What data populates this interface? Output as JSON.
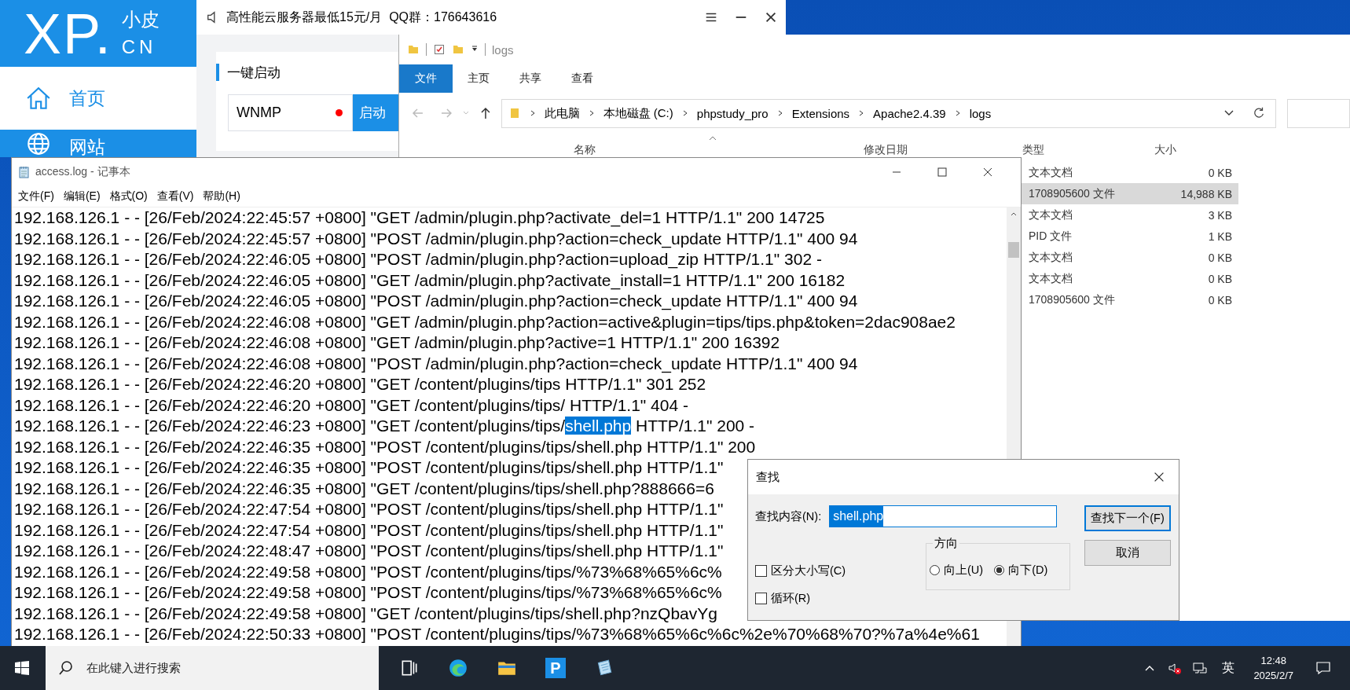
{
  "phpstudy": {
    "logo": {
      "mark": "XP.",
      "top": "小皮",
      "bottom": "CN"
    },
    "notice": "高性能云服务器最低15元/月  QQ群：176643616",
    "nav": [
      {
        "label": "首页",
        "kind": "home",
        "selected": true
      },
      {
        "label": "网站",
        "kind": "globe",
        "selected": false
      }
    ],
    "section_title": "一键启动",
    "service": {
      "name": "WNMP",
      "running": false,
      "action": "启动"
    }
  },
  "explorer": {
    "title": "logs",
    "ribbon_tabs": [
      {
        "label": "文件",
        "selected": true
      },
      {
        "label": "主页",
        "selected": false
      },
      {
        "label": "共享",
        "selected": false
      },
      {
        "label": "查看",
        "selected": false
      }
    ],
    "breadcrumb": [
      "此电脑",
      "本地磁盘 (C:)",
      "phpstudy_pro",
      "Extensions",
      "Apache2.4.39",
      "logs"
    ],
    "columns": [
      "名称",
      "修改日期",
      "类型",
      "大小"
    ],
    "rows": [
      {
        "type": "文本文档",
        "size": "0 KB",
        "selected": false
      },
      {
        "type": "1708905600 文件",
        "size": "14,988 KB",
        "selected": true
      },
      {
        "type": "文本文档",
        "size": "3 KB",
        "selected": false
      },
      {
        "type": "PID 文件",
        "size": "1 KB",
        "selected": false
      },
      {
        "type": "文本文档",
        "size": "0 KB",
        "selected": false
      },
      {
        "type": "文本文档",
        "size": "0 KB",
        "selected": false
      },
      {
        "type": "1708905600 文件",
        "size": "0 KB",
        "selected": false
      }
    ]
  },
  "notepad": {
    "title": "access.log - 记事本",
    "menu": [
      "文件(F)",
      "编辑(E)",
      "格式(O)",
      "查看(V)",
      "帮助(H)"
    ],
    "lines": [
      [
        {
          "text": "192.168.126.1 - - [26/Feb/2024:22:45:57 +0800] \"GET /admin/plugin.php?activate_del=1 HTTP/1.1\" 200 14725",
          "selected": false
        }
      ],
      [
        {
          "text": "192.168.126.1 - - [26/Feb/2024:22:45:57 +0800] \"POST /admin/plugin.php?action=check_update HTTP/1.1\" 400 94",
          "selected": false
        }
      ],
      [
        {
          "text": "192.168.126.1 - - [26/Feb/2024:22:46:05 +0800] \"POST /admin/plugin.php?action=upload_zip HTTP/1.1\" 302 -",
          "selected": false
        }
      ],
      [
        {
          "text": "192.168.126.1 - - [26/Feb/2024:22:46:05 +0800] \"GET /admin/plugin.php?activate_install=1 HTTP/1.1\" 200 16182",
          "selected": false
        }
      ],
      [
        {
          "text": "192.168.126.1 - - [26/Feb/2024:22:46:05 +0800] \"POST /admin/plugin.php?action=check_update HTTP/1.1\" 400 94",
          "selected": false
        }
      ],
      [
        {
          "text": "192.168.126.1 - - [26/Feb/2024:22:46:08 +0800] \"GET /admin/plugin.php?action=active&plugin=tips/tips.php&token=2dac908ae2",
          "selected": false
        }
      ],
      [
        {
          "text": "192.168.126.1 - - [26/Feb/2024:22:46:08 +0800] \"GET /admin/plugin.php?active=1 HTTP/1.1\" 200 16392",
          "selected": false
        }
      ],
      [
        {
          "text": "192.168.126.1 - - [26/Feb/2024:22:46:08 +0800] \"POST /admin/plugin.php?action=check_update HTTP/1.1\" 400 94",
          "selected": false
        }
      ],
      [
        {
          "text": "192.168.126.1 - - [26/Feb/2024:22:46:20 +0800] \"GET /content/plugins/tips HTTP/1.1\" 301 252",
          "selected": false
        }
      ],
      [
        {
          "text": "192.168.126.1 - - [26/Feb/2024:22:46:20 +0800] \"GET /content/plugins/tips/ HTTP/1.1\" 404 -",
          "selected": false
        }
      ],
      [
        {
          "text": "192.168.126.1 - - [26/Feb/2024:22:46:23 +0800] \"GET /content/plugins/tips/",
          "selected": false
        },
        {
          "text": "shell.php",
          "selected": true
        },
        {
          "text": " HTTP/1.1\" 200 -",
          "selected": false
        }
      ],
      [
        {
          "text": "192.168.126.1 - - [26/Feb/2024:22:46:35 +0800] \"POST /content/plugins/tips/shell.php HTTP/1.1\" 200",
          "selected": false
        }
      ],
      [
        {
          "text": "192.168.126.1 - - [26/Feb/2024:22:46:35 +0800] \"POST /content/plugins/tips/shell.php HTTP/1.1\"",
          "selected": false
        }
      ],
      [
        {
          "text": "192.168.126.1 - - [26/Feb/2024:22:46:35 +0800] \"GET /content/plugins/tips/shell.php?888666=6",
          "selected": false
        }
      ],
      [
        {
          "text": "192.168.126.1 - - [26/Feb/2024:22:47:54 +0800] \"POST /content/plugins/tips/shell.php HTTP/1.1\"",
          "selected": false
        }
      ],
      [
        {
          "text": "192.168.126.1 - - [26/Feb/2024:22:47:54 +0800] \"POST /content/plugins/tips/shell.php HTTP/1.1\"",
          "selected": false
        }
      ],
      [
        {
          "text": "192.168.126.1 - - [26/Feb/2024:22:48:47 +0800] \"POST /content/plugins/tips/shell.php HTTP/1.1\"",
          "selected": false
        }
      ],
      [
        {
          "text": "192.168.126.1 - - [26/Feb/2024:22:49:58 +0800] \"POST /content/plugins/tips/%73%68%65%6c%",
          "selected": false
        }
      ],
      [
        {
          "text": "192.168.126.1 - - [26/Feb/2024:22:49:58 +0800] \"POST /content/plugins/tips/%73%68%65%6c%",
          "selected": false
        }
      ],
      [
        {
          "text": "192.168.126.1 - - [26/Feb/2024:22:49:58 +0800] \"GET /content/plugins/tips/shell.php?nzQbavYg",
          "selected": false
        }
      ],
      [
        {
          "text": "192.168.126.1 - - [26/Feb/2024:22:50:33 +0800] \"POST /content/plugins/tips/%73%68%65%6c%6c%2e%70%68%70?%7a%4e%61",
          "selected": false
        }
      ]
    ]
  },
  "find_dialog": {
    "title": "查找",
    "find_label": "查找内容(N):",
    "find_value": "shell.php",
    "find_next": "查找下一个(F)",
    "cancel": "取消",
    "direction_label": "方向",
    "directions": [
      {
        "label": "向上(U)",
        "selected": false
      },
      {
        "label": "向下(D)",
        "selected": true
      }
    ],
    "options": [
      {
        "label": "区分大小写(C)",
        "checked": false
      },
      {
        "label": "循环(R)",
        "checked": false
      }
    ]
  },
  "taskbar": {
    "search_placeholder": "在此键入进行搜索",
    "apps": [
      {
        "kind": "taskview"
      },
      {
        "kind": "edge"
      },
      {
        "kind": "folder"
      },
      {
        "kind": "letter",
        "label": "P"
      },
      {
        "kind": "notepad"
      }
    ],
    "ime": "英",
    "time": "12:48",
    "date": "2025/2/7"
  }
}
